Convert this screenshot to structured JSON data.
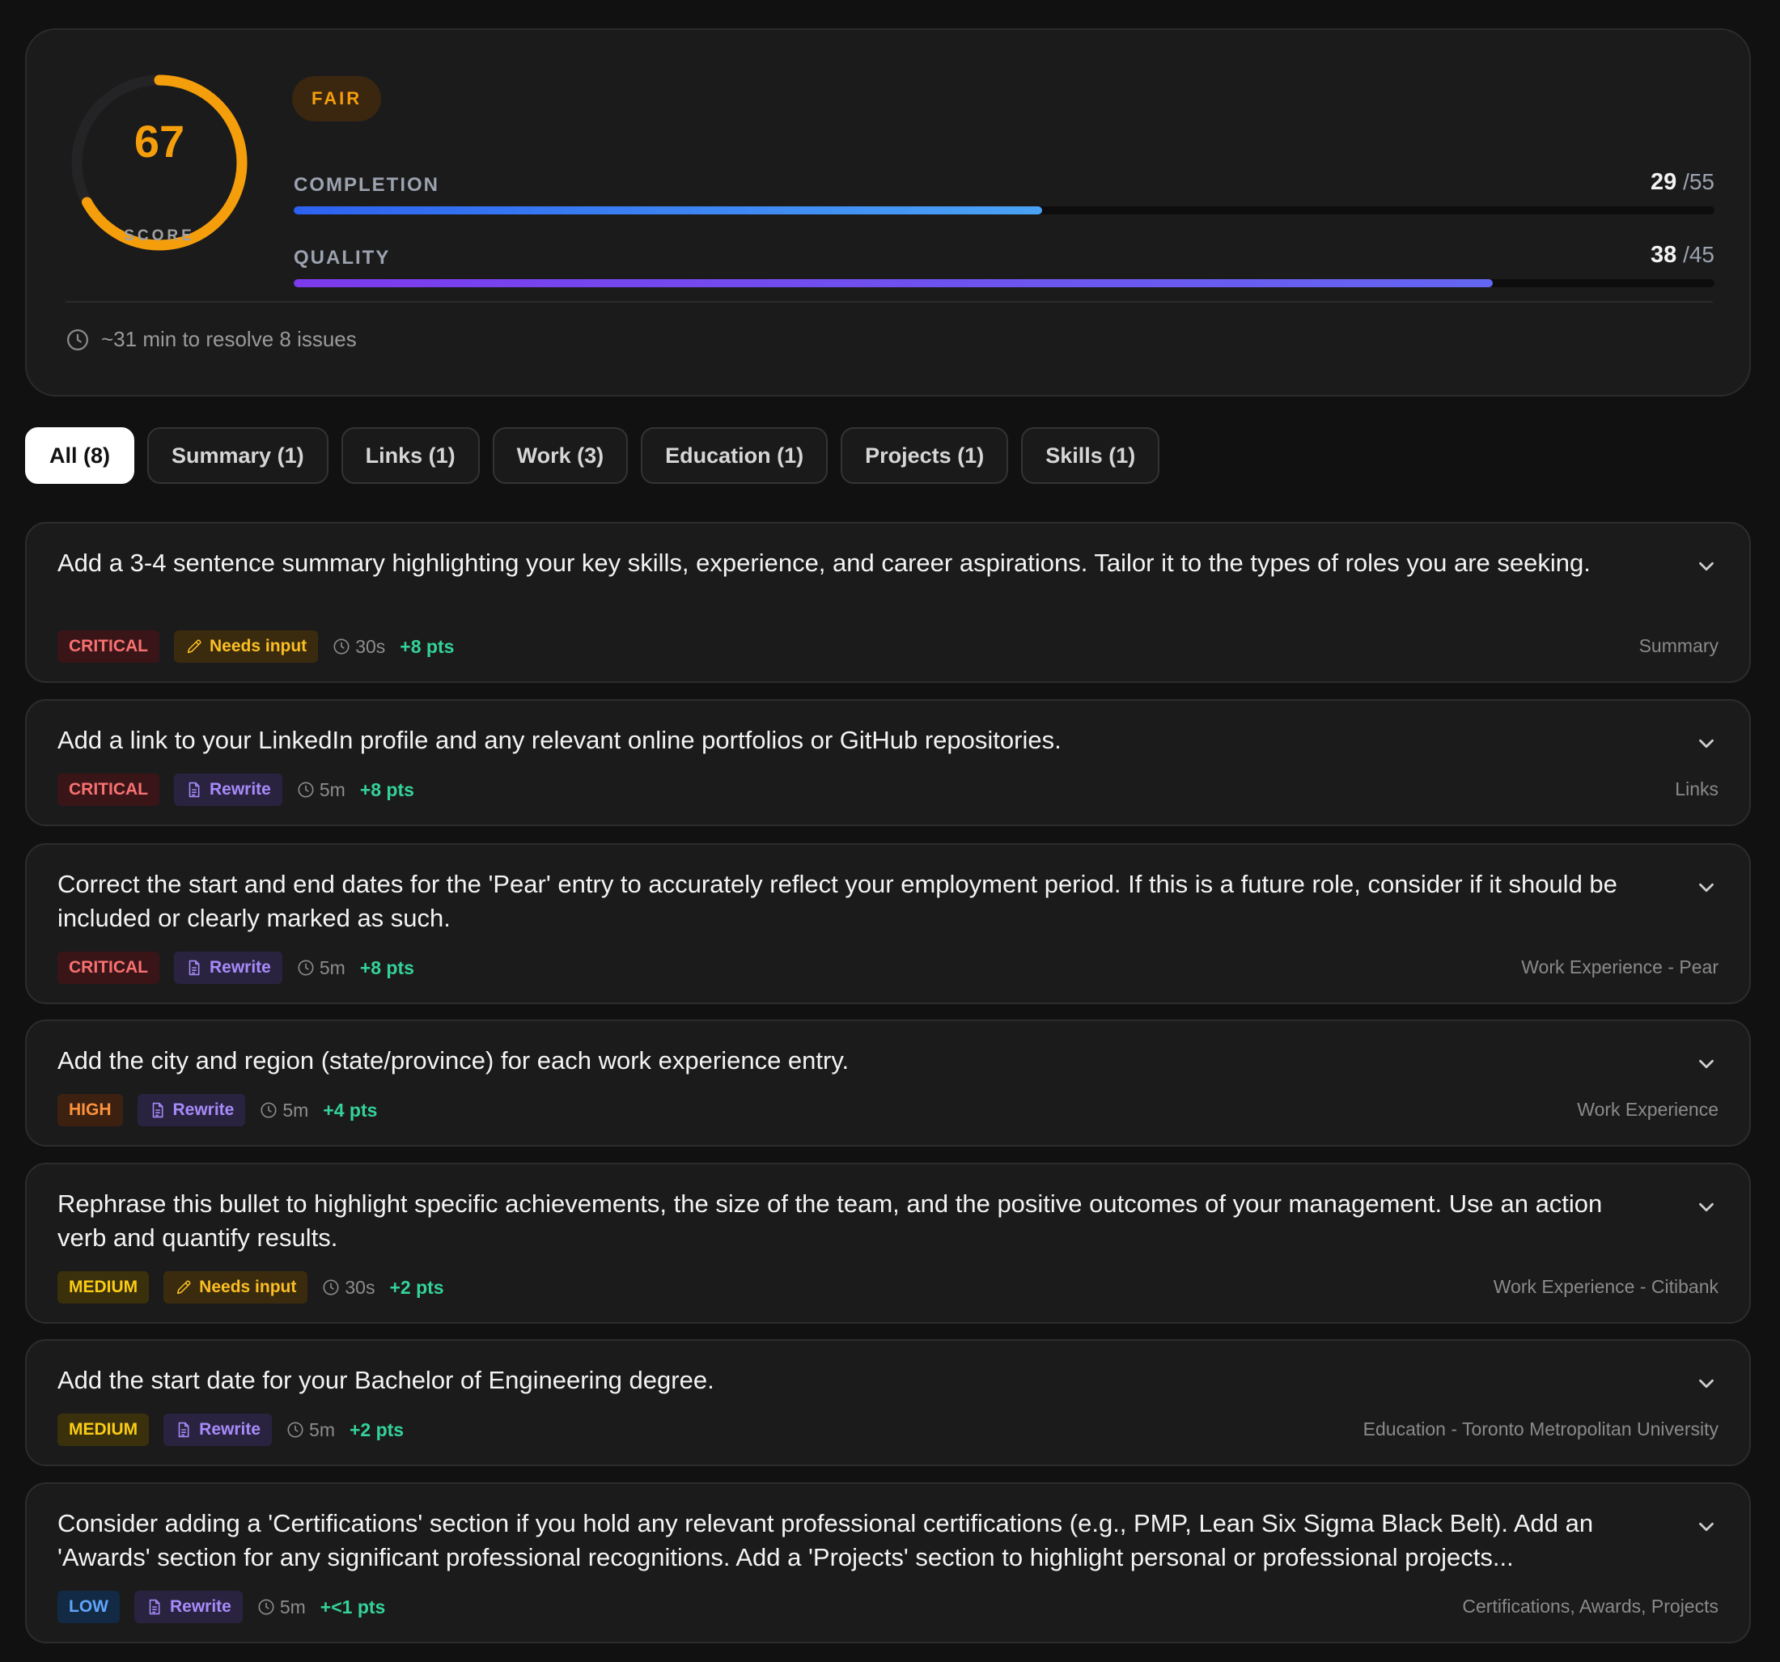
{
  "score": {
    "value": "67",
    "label": "SCORE",
    "fraction": 0.67,
    "grade": "FAIR",
    "ring_color": "#f59e0b"
  },
  "metrics": [
    {
      "label": "COMPLETION",
      "value": "29",
      "max": "/55",
      "fraction": 0.527
    },
    {
      "label": "QUALITY",
      "value": "38",
      "max": "/45",
      "fraction": 0.844
    }
  ],
  "eta": {
    "icon": "clock-icon",
    "text": "~31 min to resolve 8 issues"
  },
  "tabs": [
    {
      "label": "All (8)",
      "active": true
    },
    {
      "label": "Summary (1)"
    },
    {
      "label": "Links (1)"
    },
    {
      "label": "Work (3)"
    },
    {
      "label": "Education (1)"
    },
    {
      "label": "Projects (1)"
    },
    {
      "label": "Skills (1)"
    }
  ],
  "issues": [
    {
      "text": "Add a 3-4 sentence summary highlighting your key skills, experience, and career aspirations. Tailor it to the types of roles you are seeking.",
      "severity": "CRITICAL",
      "action": "Needs input",
      "time": "30s",
      "points": "+8 pts",
      "section": "Summary"
    },
    {
      "text": "Add a link to your LinkedIn profile and any relevant online portfolios or GitHub repositories.",
      "severity": "CRITICAL",
      "action": "Rewrite",
      "time": "5m",
      "points": "+8 pts",
      "section": "Links"
    },
    {
      "text": "Correct the start and end dates for the 'Pear' entry to accurately reflect your employment period. If this is a future role, consider if it should be included or clearly marked as such.",
      "severity": "CRITICAL",
      "action": "Rewrite",
      "time": "5m",
      "points": "+8 pts",
      "section": "Work Experience - Pear"
    },
    {
      "text": "Add the city and region (state/province) for each work experience entry.",
      "severity": "HIGH",
      "action": "Rewrite",
      "time": "5m",
      "points": "+4 pts",
      "section": "Work Experience"
    },
    {
      "text": "Rephrase this bullet to highlight specific achievements, the size of the team, and the positive outcomes of your management. Use an action verb and quantify results.",
      "severity": "MEDIUM",
      "action": "Needs input",
      "time": "30s",
      "points": "+2 pts",
      "section": "Work Experience - Citibank"
    },
    {
      "text": "Add the start date for your Bachelor of Engineering degree.",
      "severity": "MEDIUM",
      "action": "Rewrite",
      "time": "5m",
      "points": "+2 pts",
      "section": "Education - Toronto Metropolitan University"
    },
    {
      "text": "Consider adding a 'Certifications' section if you hold any relevant professional certifications (e.g., PMP, Lean Six Sigma Black Belt). Add an 'Awards' section for any significant professional recognitions. Add a 'Projects' section to highlight personal or professional projects...",
      "severity": "LOW",
      "action": "Rewrite",
      "time": "5m",
      "points": "+<1 pts",
      "section": "Certifications, Awards, Projects"
    }
  ],
  "icons": {
    "needs_input": "pencil-icon",
    "rewrite": "document-icon",
    "time": "clock-icon",
    "expand": "chevron-down-icon"
  }
}
